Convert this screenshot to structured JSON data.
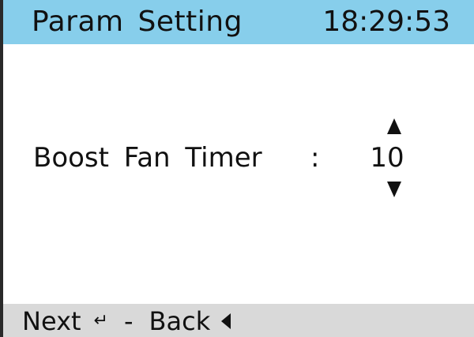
{
  "header": {
    "title": "Param  Setting",
    "clock": "18:29:53"
  },
  "param": {
    "label": "Boost  Fan  Timer",
    "colon": ":",
    "value": "10"
  },
  "footer": {
    "next_label": "Next",
    "enter_glyph": "↵",
    "separator": "-",
    "back_label": "Back"
  },
  "icons": {
    "increment": "triangle-up-icon",
    "decrement": "triangle-down-icon",
    "enter": "enter-icon",
    "back": "triangle-left-icon"
  },
  "colors": {
    "header_bg": "#87ceeb",
    "footer_bg": "#d9d9d9",
    "text": "#111111"
  }
}
